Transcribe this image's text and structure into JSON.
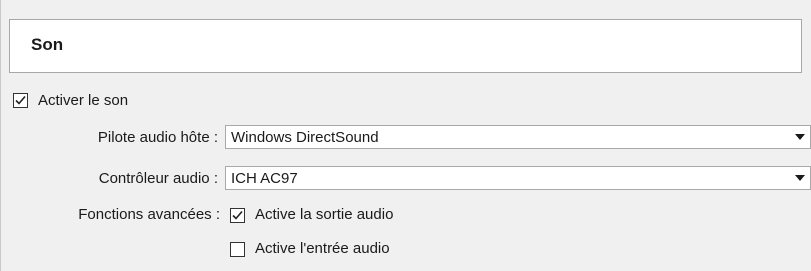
{
  "section": {
    "title": "Son"
  },
  "enable_sound": {
    "label": "Activer le son",
    "checked": true
  },
  "host_driver": {
    "label": "Pilote audio hôte :",
    "value": "Windows DirectSound",
    "icon": "chevron-down-icon"
  },
  "controller": {
    "label": "Contrôleur audio :",
    "value": "ICH AC97",
    "icon": "chevron-down-icon"
  },
  "advanced": {
    "label": "Fonctions avancées :",
    "output": {
      "label": "Active la sortie audio",
      "checked": true
    },
    "input": {
      "label": "Active l'entrée audio",
      "checked": false
    }
  }
}
